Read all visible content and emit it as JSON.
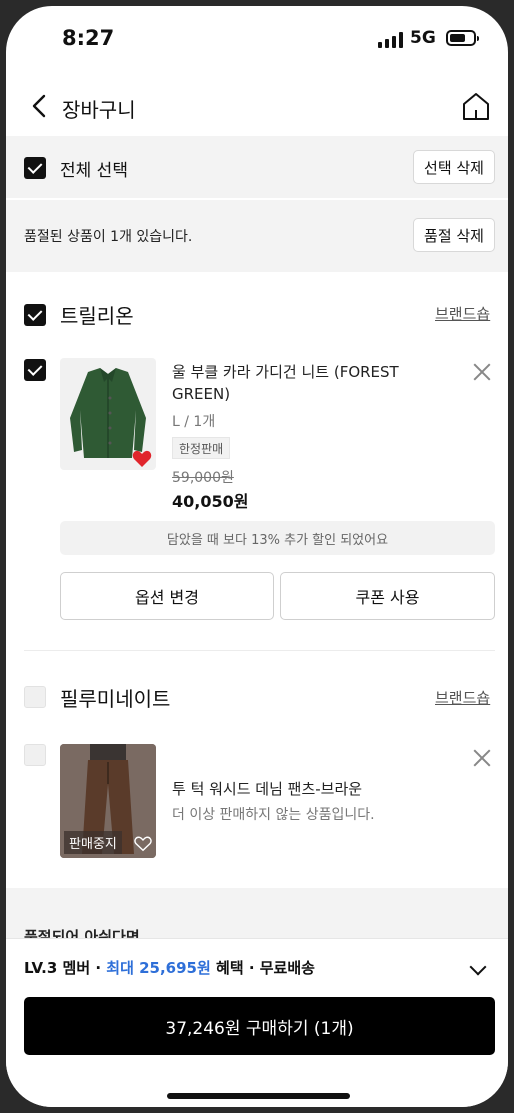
{
  "status_bar": {
    "time": "8:27",
    "network": "5G"
  },
  "header": {
    "title": "장바구니"
  },
  "select_all": {
    "label": "전체 선택",
    "delete_button": "선택 삭제"
  },
  "sold_out_bar": {
    "text": "품절된 상품이 1개 있습니다.",
    "delete_button": "품절 삭제"
  },
  "brands": [
    {
      "name": "트릴리온",
      "shop_link": "브랜드숍",
      "checked": true,
      "item": {
        "title_line1": "울 부클 카라 가디건 니트 (FOREST",
        "title_line2": "GREEN)",
        "option": "L / 1개",
        "tag": "한정판매",
        "original_price": "59,000원",
        "price": "40,050원",
        "notice": "담았을 때 보다 13% 추가 할인 되었어요",
        "option_button": "옵션 변경",
        "coupon_button": "쿠폰 사용"
      }
    },
    {
      "name": "필루미네이트",
      "shop_link": "브랜드숍",
      "checked": false,
      "item": {
        "title": "투 턱 워시드 데님 팬츠-브라운",
        "status": "더 이상 판매하지 않는 상품입니다.",
        "badge": "판매중지"
      }
    }
  ],
  "partial_section": {
    "text": "품절되어 아쉬다면"
  },
  "footer": {
    "member_level": "LV.3 멤버 · ",
    "benefit_highlight": "최대 25,695원",
    "benefit_rest": " 혜택 · 무료배송",
    "buy_button": "37,246원 구매하기 (1개)"
  },
  "colors": {
    "accent_blue": "#2e6fd8",
    "heart_red": "#e0252c",
    "buy_button_bg": "#000000"
  }
}
